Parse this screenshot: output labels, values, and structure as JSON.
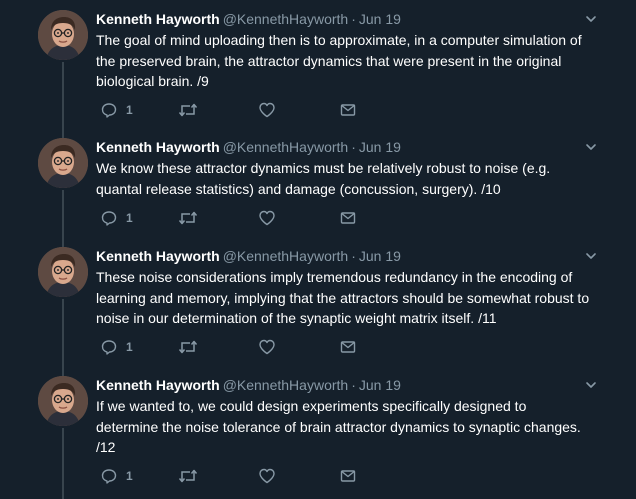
{
  "colors": {
    "background": "#15202b",
    "text": "#ffffff",
    "muted": "#8899a6",
    "thread_line": "#38444d"
  },
  "tweets": [
    {
      "name": "Kenneth Hayworth",
      "handle": "@KennethHayworth",
      "separator": "·",
      "date": "Jun 19",
      "text_lines": [
        "The goal of mind uploading then is to approximate, in a computer simulation of",
        "the preserved brain, the attractor dynamics that were present in the original",
        "biological brain.  /9"
      ],
      "reply_count": "1",
      "icons": [
        "chevron-down-icon",
        "reply-icon",
        "retweet-icon",
        "heart-icon",
        "mail-icon"
      ]
    },
    {
      "name": "Kenneth Hayworth",
      "handle": "@KennethHayworth",
      "separator": "·",
      "date": "Jun 19",
      "text_lines": [
        "We know these attractor dynamics must be relatively robust to noise (e.g.",
        "quantal release statistics) and damage (concussion, surgery). /10"
      ],
      "reply_count": "1",
      "icons": [
        "chevron-down-icon",
        "reply-icon",
        "retweet-icon",
        "heart-icon",
        "mail-icon"
      ]
    },
    {
      "name": "Kenneth Hayworth",
      "handle": "@KennethHayworth",
      "separator": "·",
      "date": "Jun 19",
      "text_lines": [
        "These noise considerations imply tremendous redundancy in the encoding of",
        "learning and memory, implying that the attractors should be somewhat robust to",
        "noise in our determination of the synaptic weight matrix itself. /11"
      ],
      "reply_count": "1",
      "icons": [
        "chevron-down-icon",
        "reply-icon",
        "retweet-icon",
        "heart-icon",
        "mail-icon"
      ]
    },
    {
      "name": "Kenneth Hayworth",
      "handle": "@KennethHayworth",
      "separator": "·",
      "date": "Jun 19",
      "text_lines": [
        "If we wanted to, we could design experiments specifically designed to",
        "determine the noise tolerance of brain attractor dynamics to synaptic changes.",
        "/12"
      ],
      "reply_count": "1",
      "icons": [
        "chevron-down-icon",
        "reply-icon",
        "retweet-icon",
        "heart-icon",
        "mail-icon"
      ]
    }
  ]
}
